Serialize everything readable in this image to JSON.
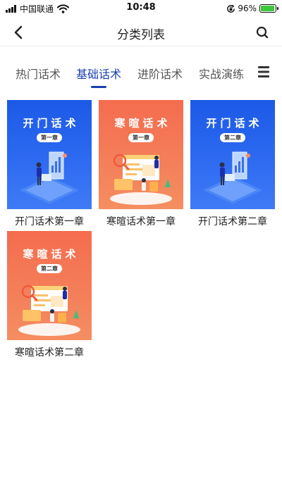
{
  "status_bar": {
    "carrier": "中国联通",
    "time": "10:48",
    "battery_percent": "96%",
    "battery_level": 0.96,
    "icons": [
      "signal-icon",
      "wifi-icon",
      "orientation-lock-icon",
      "battery-charging-icon"
    ]
  },
  "nav": {
    "title": "分类列表",
    "icons": [
      "back-icon",
      "search-icon"
    ]
  },
  "tabs": {
    "items": [
      {
        "label": "热门话术",
        "active": false
      },
      {
        "label": "基础话术",
        "active": true
      },
      {
        "label": "进阶话术",
        "active": false
      },
      {
        "label": "实战演练",
        "active": false
      }
    ],
    "menu_icon": "list-menu-icon",
    "active_color": "#1a3fb0"
  },
  "items": [
    {
      "cover_title": "开门话术",
      "badge": "第一章",
      "title": "开门话术第一章",
      "theme": "blue"
    },
    {
      "cover_title": "寒暄话术",
      "badge": "第一章",
      "title": "寒暄话术第一章",
      "theme": "orange"
    },
    {
      "cover_title": "开门话术",
      "badge": "第二章",
      "title": "开门话术第二章",
      "theme": "blue"
    },
    {
      "cover_title": "寒暄话术",
      "badge": "第二章",
      "title": "寒暄话术第二章",
      "theme": "orange"
    }
  ],
  "colors": {
    "blue_cover": "#1c59e6",
    "orange_cover": "#f46c4e",
    "accent": "#1a3fb0"
  }
}
